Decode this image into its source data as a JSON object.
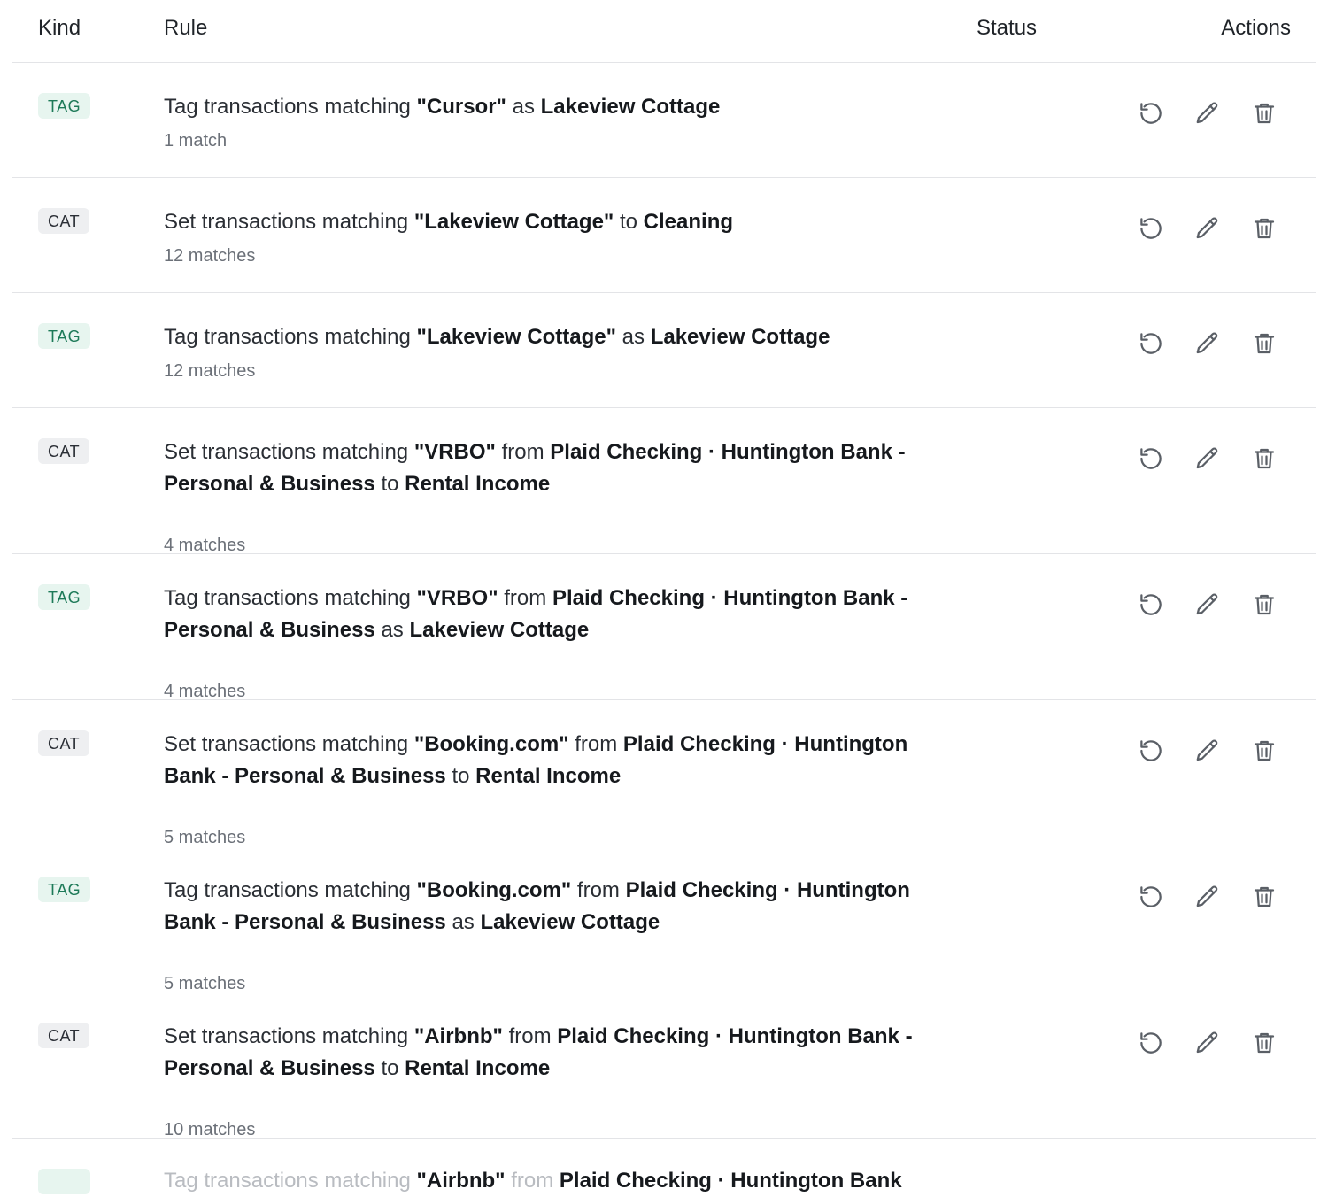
{
  "header": {
    "kind": "Kind",
    "rule": "Rule",
    "status": "Status",
    "actions": "Actions"
  },
  "rows": [
    {
      "kind": "TAG",
      "verb": "Tag transactions matching",
      "match": "\"Cursor\"",
      "from_label": "",
      "account": "",
      "connector": "as",
      "target": "Lakeview Cottage",
      "matches": "1 match"
    },
    {
      "kind": "CAT",
      "verb": "Set transactions matching",
      "match": "\"Lakeview Cottage\"",
      "from_label": "",
      "account": "",
      "connector": "to",
      "target": "Cleaning",
      "matches": "12 matches"
    },
    {
      "kind": "TAG",
      "verb": "Tag transactions matching",
      "match": "\"Lakeview Cottage\"",
      "from_label": "",
      "account": "",
      "connector": "as",
      "target": "Lakeview Cottage",
      "matches": "12 matches"
    },
    {
      "kind": "CAT",
      "verb": "Set transactions matching",
      "match": "\"VRBO\"",
      "from_label": "from",
      "account": "Plaid Checking · Huntington Bank - Personal & Business",
      "connector": "to",
      "target": "Rental Income",
      "matches": "4 matches"
    },
    {
      "kind": "TAG",
      "verb": "Tag transactions matching",
      "match": "\"VRBO\"",
      "from_label": "from",
      "account": "Plaid Checking · Huntington Bank - Personal & Business",
      "connector": "as",
      "target": "Lakeview Cottage",
      "matches": "4 matches"
    },
    {
      "kind": "CAT",
      "verb": "Set transactions matching",
      "match": "\"Booking.com\"",
      "from_label": "from",
      "account": "Plaid Checking · Huntington Bank - Personal & Business",
      "connector": "to",
      "target": "Rental Income",
      "matches": "5 matches"
    },
    {
      "kind": "TAG",
      "verb": "Tag transactions matching",
      "match": "\"Booking.com\"",
      "from_label": "from",
      "account": "Plaid Checking · Huntington Bank - Personal & Business",
      "connector": "as",
      "target": "Lakeview Cottage",
      "matches": "5 matches"
    },
    {
      "kind": "CAT",
      "verb": "Set transactions matching",
      "match": "\"Airbnb\"",
      "from_label": "from",
      "account": "Plaid Checking · Huntington Bank - Personal & Business",
      "connector": "to",
      "target": "Rental Income",
      "matches": "10 matches"
    }
  ],
  "partial_row": {
    "verb": "Tag transactions matching",
    "match": "\"Airbnb\"",
    "from_label": "from",
    "account": "Plaid Checking · Huntington Bank"
  },
  "actions": {
    "rerun_icon": "rotate-ccw-icon",
    "edit_icon": "pencil-icon",
    "delete_icon": "trash-icon"
  },
  "colors": {
    "tag_bg": "#e7f5ef",
    "tag_fg": "#1d7a58",
    "cat_bg": "#eeeff1",
    "cat_fg": "#2b2f36",
    "muted": "#6b7078",
    "border": "#e3e4e7"
  }
}
